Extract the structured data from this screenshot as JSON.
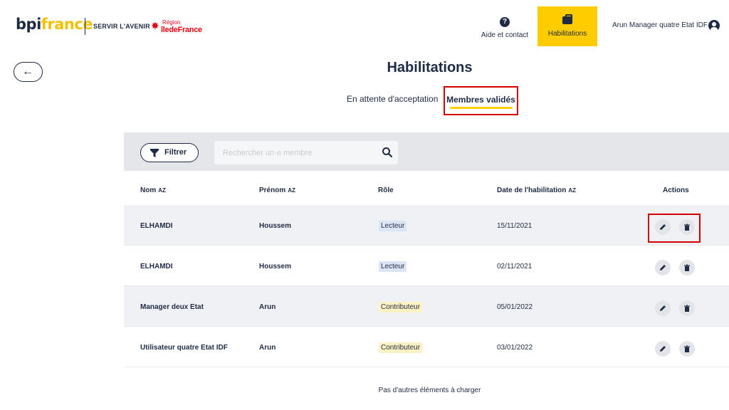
{
  "header": {
    "logo_bpi_part1": "bpi",
    "logo_bpi_part2": "france",
    "logo_tagline": "SERVIR L'AVENIR",
    "logo_region_line1": "Région",
    "logo_region_line2": "îledeFrance",
    "help_label": "Aide et contact",
    "habilitations_label": "Habilitations",
    "user_name": "Arun Manager quatre Etat IDF"
  },
  "page": {
    "title": "Habilitations",
    "tabs": [
      {
        "label": "En attente d'acceptation",
        "active": false
      },
      {
        "label": "Membres validés",
        "active": true
      }
    ]
  },
  "toolbar": {
    "filter_label": "Filtrer",
    "search_placeholder": "Rechercher un·e membre"
  },
  "table": {
    "columns": [
      "Nom",
      "Prénom",
      "Rôle",
      "Date de l'habilitation",
      "Actions"
    ],
    "sort_glyph": "AZ",
    "rows": [
      {
        "nom": "ELHAMDI",
        "prenom": "Houssem",
        "role": "Lecteur",
        "date": "15/11/2021"
      },
      {
        "nom": "ELHAMDI",
        "prenom": "Houssem",
        "role": "Lecteur",
        "date": "02/11/2021"
      },
      {
        "nom": "Manager deux Etat",
        "prenom": "Arun",
        "role": "Contributeur",
        "date": "05/01/2022"
      },
      {
        "nom": "Utilisateur quatre Etat IDF",
        "prenom": "Arun",
        "role": "Contributeur",
        "date": "03/01/2022"
      }
    ]
  },
  "footer_text": "Pas d'autres éléments à charger",
  "colors": {
    "accent_yellow": "#ffcc00",
    "navy": "#1f2a44",
    "highlight_red": "#d40000",
    "role_lecteur_bg": "#dce5f5",
    "role_contributeur_bg": "#fdf2c4"
  }
}
